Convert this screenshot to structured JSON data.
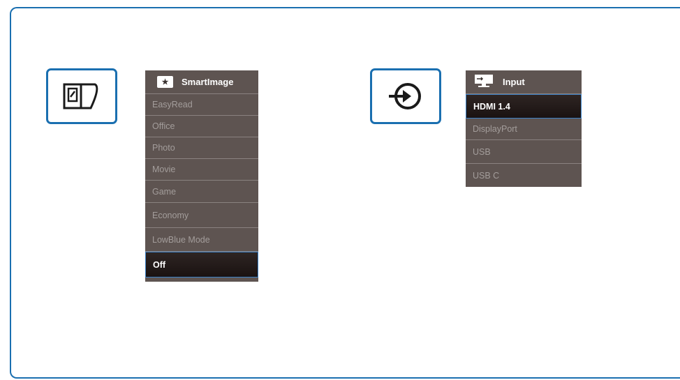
{
  "smartimage_menu": {
    "title": "SmartImage",
    "icon": "star-icon",
    "items": [
      {
        "label": "EasyRead"
      },
      {
        "label": "Office"
      },
      {
        "label": "Photo"
      },
      {
        "label": "Movie"
      },
      {
        "label": "Game"
      },
      {
        "label": "Economy"
      },
      {
        "label": "LowBlue Mode"
      },
      {
        "label": "Off",
        "selected": true
      }
    ]
  },
  "input_menu": {
    "title": "Input",
    "icon": "monitor-input-icon",
    "items": [
      {
        "label": "HDMI 1.4",
        "selected": true
      },
      {
        "label": "DisplayPort"
      },
      {
        "label": "USB"
      },
      {
        "label": "USB C"
      }
    ]
  },
  "colors": {
    "accent": "#1a6fb0",
    "menu_background": "#5e5451",
    "selected_background": "#1f1716"
  }
}
